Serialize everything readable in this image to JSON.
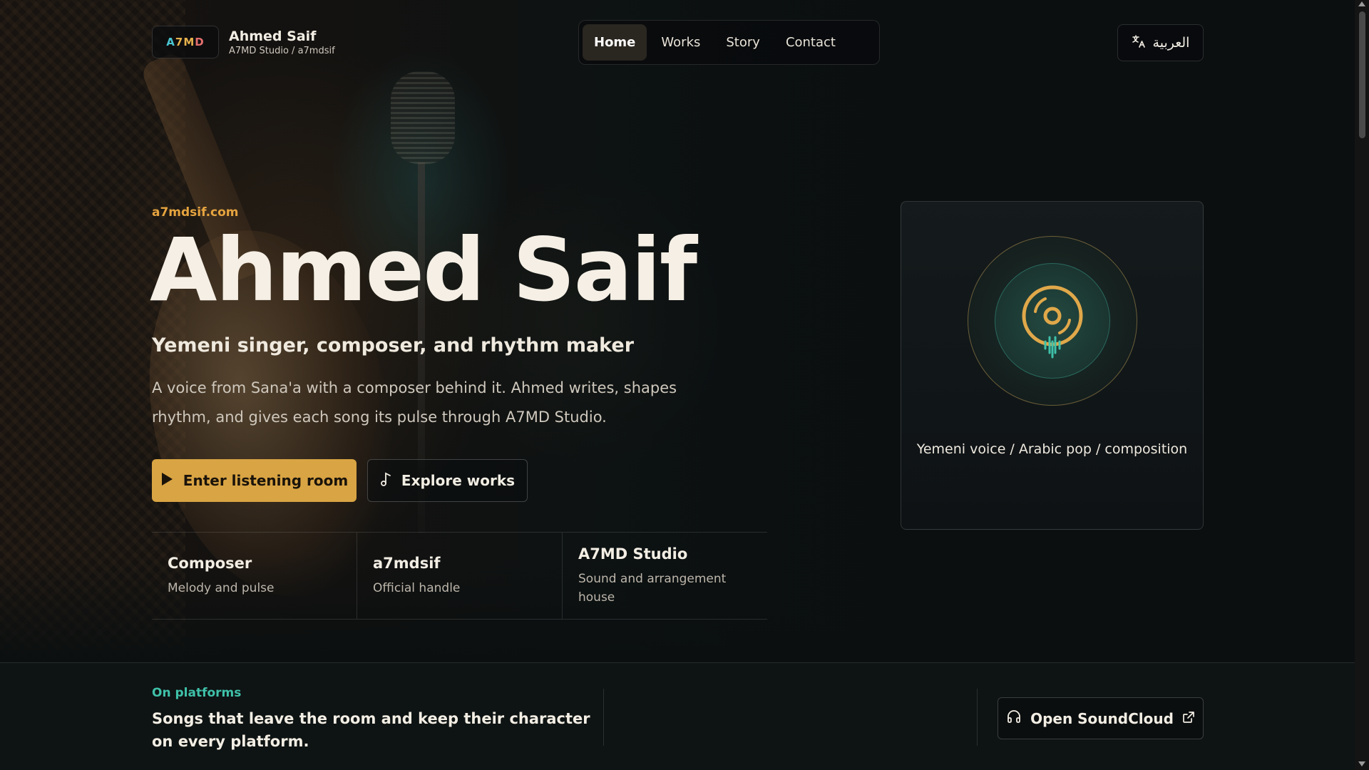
{
  "brand": {
    "logo": [
      "A",
      "7",
      "M",
      "D"
    ],
    "name": "Ahmed Saif",
    "subtitle": "A7MD Studio / a7mdsif"
  },
  "nav": {
    "items": [
      "Home",
      "Works",
      "Story",
      "Contact"
    ],
    "active": "Home"
  },
  "language_button": {
    "label": "العربية",
    "icon": "translate-icon"
  },
  "hero": {
    "domain": "a7mdsif.com",
    "title": "Ahmed Saif",
    "subtitle": "Yemeni singer, composer, and rhythm maker",
    "description": "A voice from Sana'a with a composer behind it. Ahmed writes, shapes rhythm, and gives each song its pulse through A7MD Studio.",
    "primary_button": {
      "label": "Enter listening room",
      "icon": "play-icon"
    },
    "secondary_button": {
      "label": "Explore works",
      "icon": "music-note-icon"
    }
  },
  "stats": [
    {
      "title": "Composer",
      "desc": "Melody and pulse"
    },
    {
      "title": "a7mdsif",
      "desc": "Official handle"
    },
    {
      "title": "A7MD Studio",
      "desc": "Sound and arrangement house"
    }
  ],
  "card": {
    "caption": "Yemeni voice / Arabic pop / composition",
    "icon": "vinyl-disc-icon"
  },
  "platforms": {
    "label": "On platforms",
    "text": "Songs that leave the room and keep their character on every platform.",
    "button": {
      "label": "Open SoundCloud",
      "icon": "headphones-icon",
      "trailing_icon": "external-link-icon"
    }
  },
  "colors": {
    "accent": "#d9a443",
    "teal": "#3fc1a9",
    "background": "#0b0f10",
    "text": "#f3eee4"
  }
}
